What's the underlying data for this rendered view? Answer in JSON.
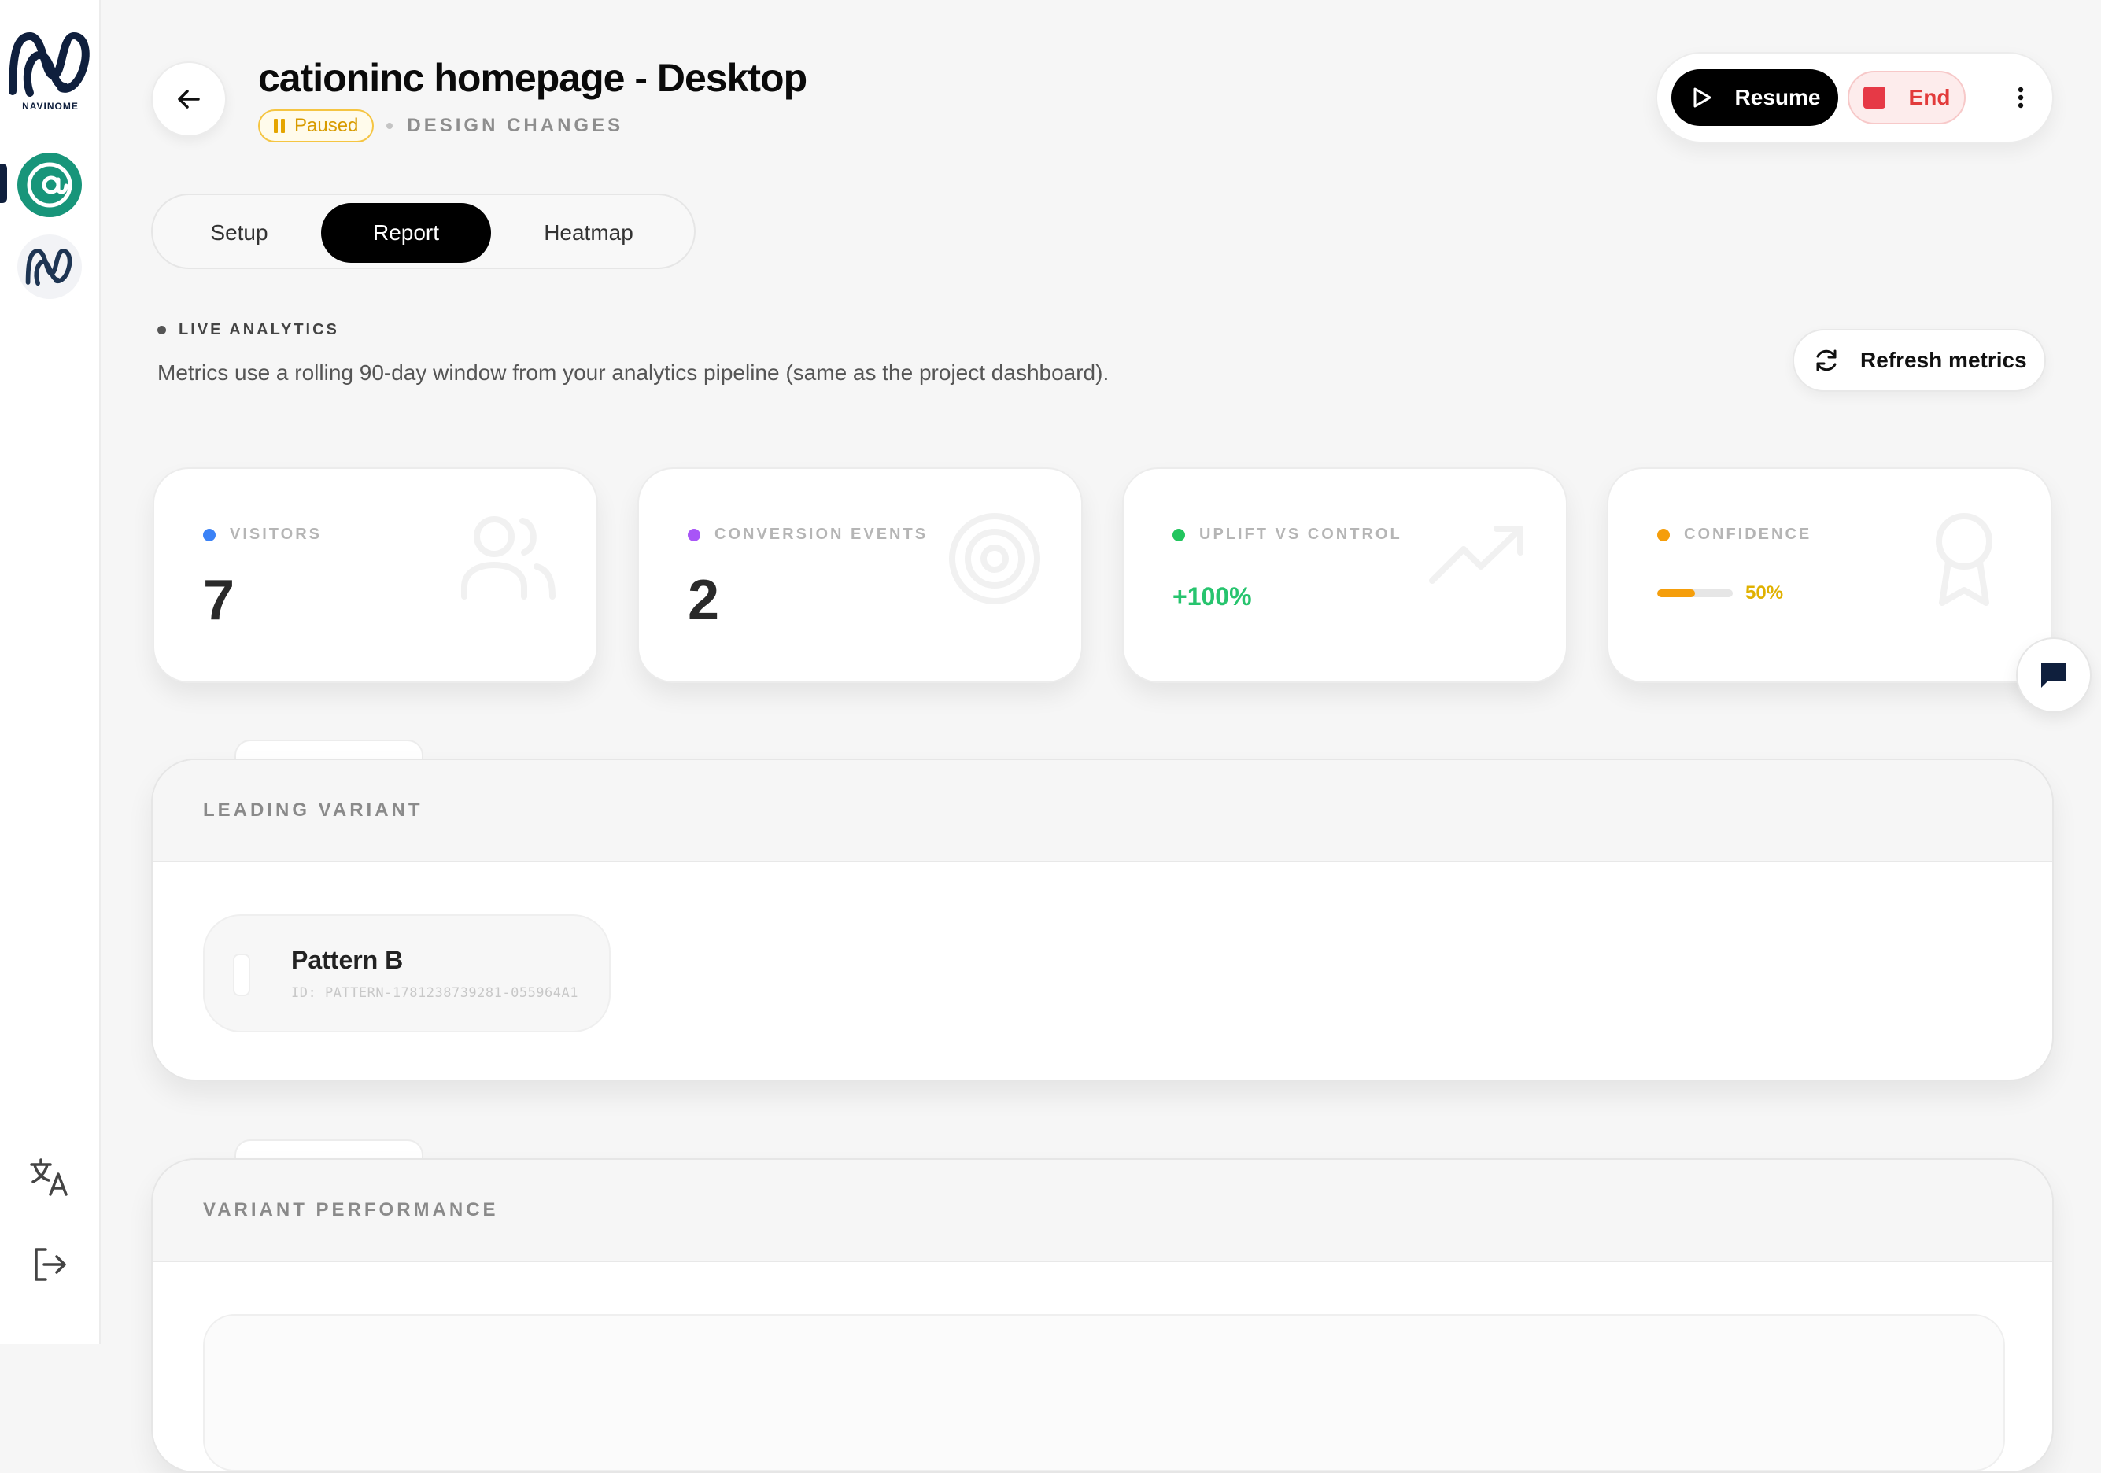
{
  "sidebar": {
    "brand_name": "NAVINOME",
    "project_avatar_glyph": "@",
    "icons": [
      "translate-icon",
      "logout-icon"
    ]
  },
  "header": {
    "title": "cationinc homepage - Desktop",
    "status": "Paused",
    "category": "DESIGN CHANGES",
    "resume_label": "Resume",
    "end_label": "End"
  },
  "tabs": [
    {
      "label": "Setup",
      "active": false
    },
    {
      "label": "Report",
      "active": true
    },
    {
      "label": "Heatmap",
      "active": false
    }
  ],
  "analytics": {
    "live_label": "LIVE ANALYTICS",
    "description": "Metrics use a rolling 90-day window from your analytics pipeline (same as the project dashboard).",
    "refresh_label": "Refresh metrics"
  },
  "metrics": {
    "visitors": {
      "label": "VISITORS",
      "value": "7",
      "dot_color": "#3b82f6"
    },
    "conversions": {
      "label": "CONVERSION EVENTS",
      "value": "2",
      "dot_color": "#a855f7"
    },
    "uplift": {
      "label": "UPLIFT VS CONTROL",
      "value": "+100%",
      "dot_color": "#22c55e",
      "value_color": "#27c46e"
    },
    "confidence": {
      "label": "CONFIDENCE",
      "value": "50%",
      "fraction": 0.5,
      "dot_color": "#f59e0b"
    }
  },
  "leading_variant": {
    "title": "LEADING VARIANT",
    "name": "Pattern B",
    "id": "ID: PATTERN-1781238739281-055964A1"
  },
  "variant_performance": {
    "title": "VARIANT PERFORMANCE"
  },
  "colors": {
    "accent": "#000000",
    "paused": "#d89b00",
    "end": "#e23b3b",
    "brand": "#0f1f3d",
    "project": "#18957a"
  }
}
